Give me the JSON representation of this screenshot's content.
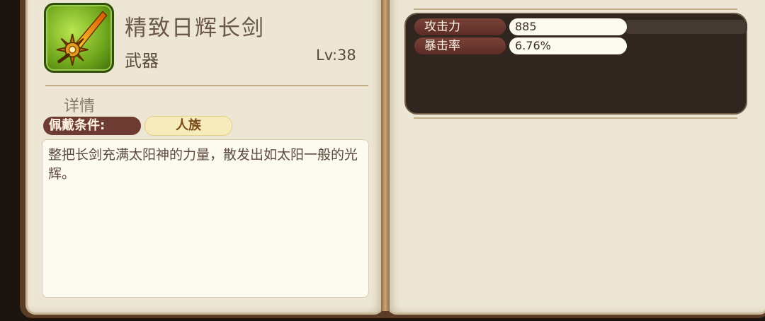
{
  "item": {
    "name": "精致日辉长剑",
    "type": "武器",
    "level": "Lv:38",
    "icon": "sun-sword-icon"
  },
  "details": {
    "label": "详情",
    "requirement_label": "佩戴条件:",
    "requirement_value": "人族",
    "description": "整把长剑充满太阳神的力量，散发出如太阳一般的光辉。"
  },
  "stats": [
    {
      "label": "攻击力",
      "value": "885"
    },
    {
      "label": "暴击率",
      "value": "6.76%"
    }
  ],
  "colors": {
    "page": "#ede6d4",
    "stat_label": "#6e3b32",
    "stat_panel": "#31261f",
    "requirement_value_bg": "#f6ebba"
  }
}
